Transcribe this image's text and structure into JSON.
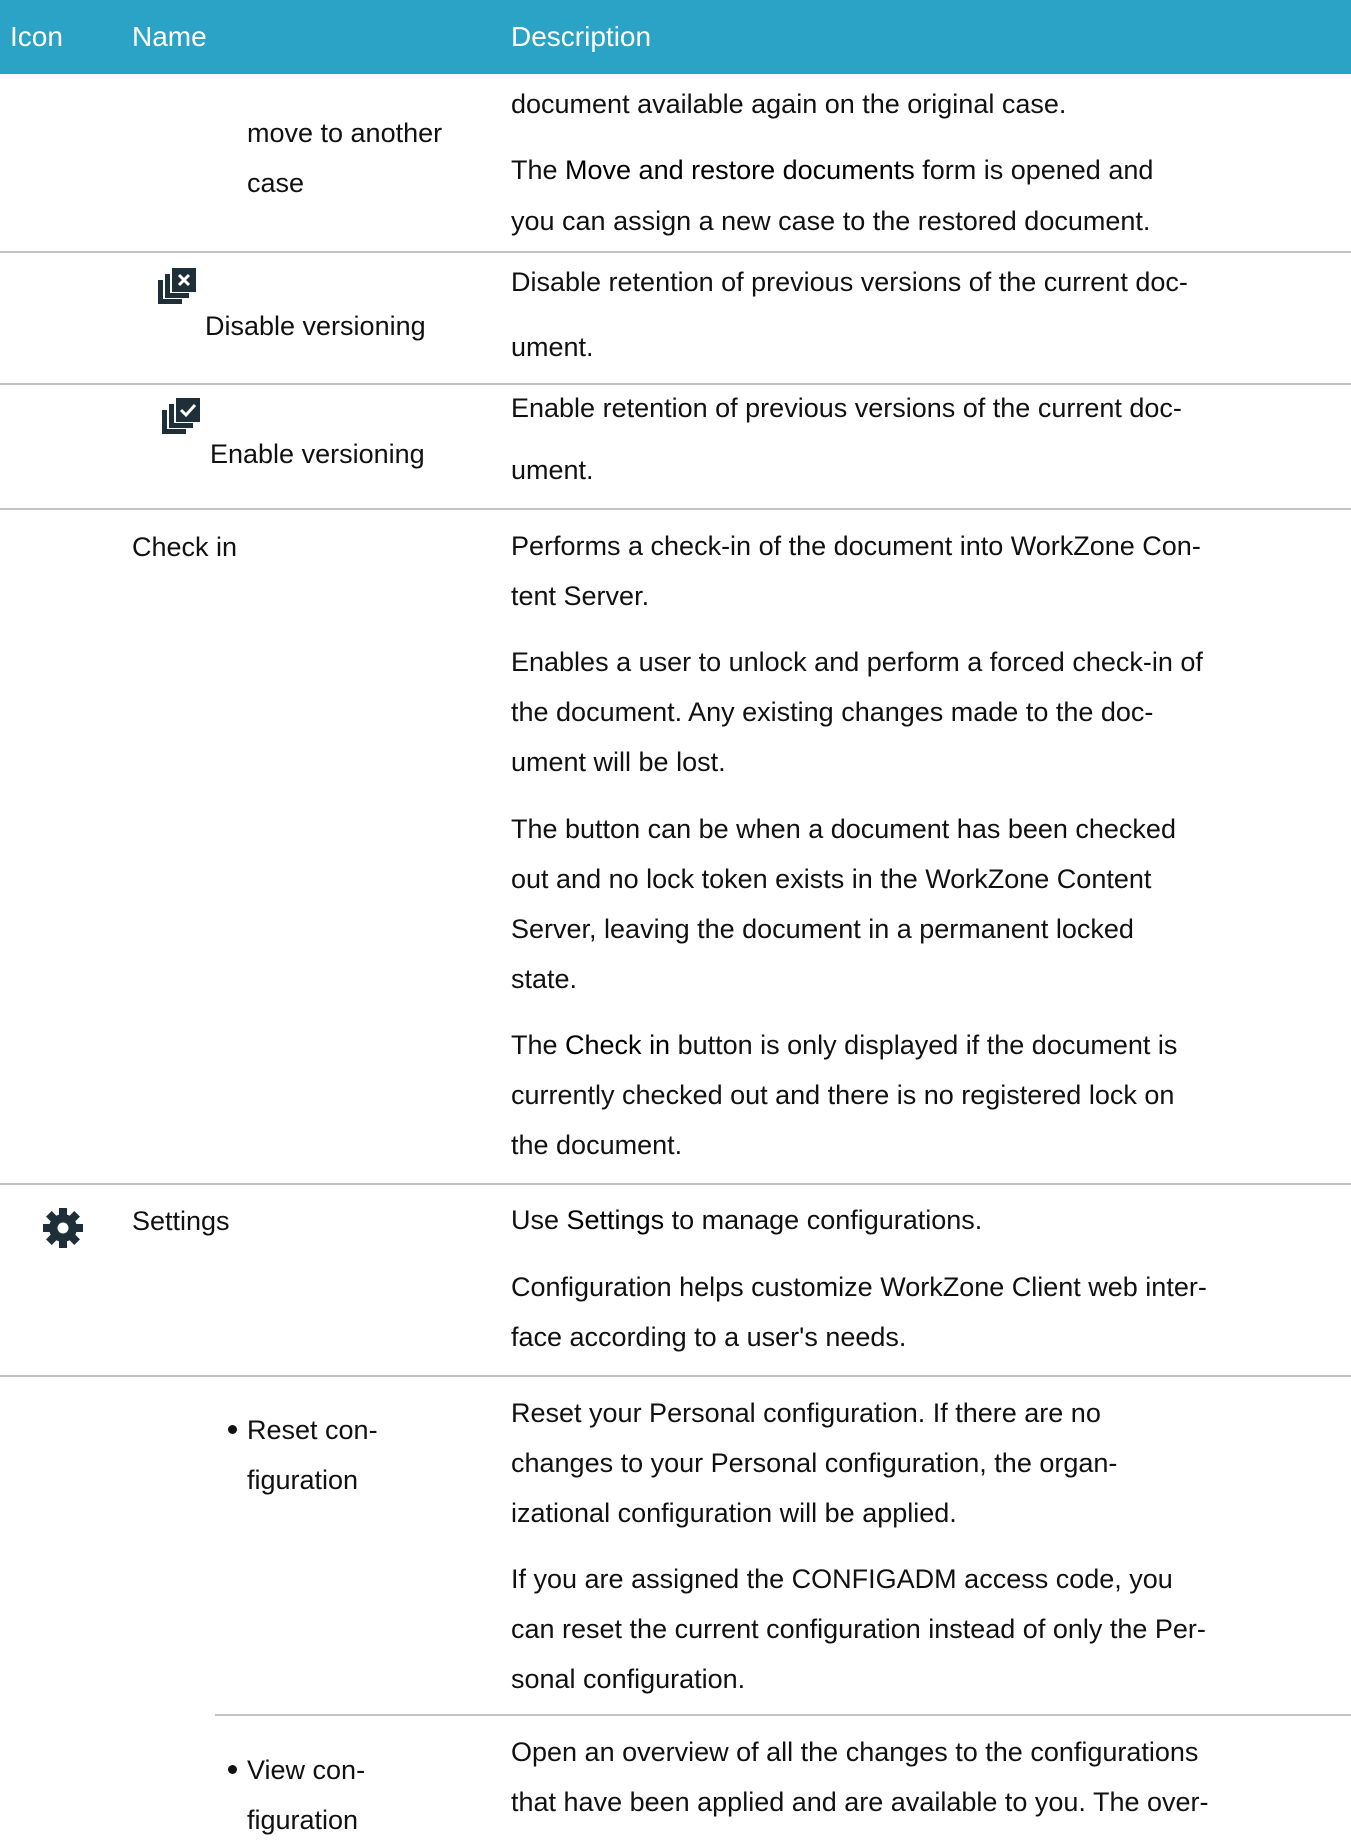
{
  "header": {
    "icon": "Icon",
    "name": "Name",
    "description": "Description"
  },
  "rows": [
    {
      "name_lines": [
        "move to another",
        "case"
      ],
      "desc_lines": [
        [
          "document available again on the original case."
        ],
        [
          "The ",
          {
            "b": "Move and restore documents"
          },
          " form is opened and"
        ],
        [
          "you can assign a new case to the restored document."
        ]
      ]
    },
    {
      "icon": "disable-versioning-icon",
      "name": "Disable versioning",
      "desc_lines": [
        [
          "Disable retention of previous versions of the current doc-"
        ],
        [
          "ument."
        ]
      ]
    },
    {
      "icon": "enable-versioning-icon",
      "name": "Enable versioning",
      "desc_lines": [
        [
          "Enable retention of previous versions of the current doc-"
        ],
        [
          "ument."
        ]
      ]
    },
    {
      "name": "Check in",
      "desc_lines": [
        [
          "Performs a check-in of the document into WorkZone Con-"
        ],
        [
          "tent Server."
        ],
        [
          "Enables a user to unlock and perform a forced check-in of"
        ],
        [
          "the document. Any existing changes made to the doc-"
        ],
        [
          "ument will be lost."
        ],
        [
          "The button can be when a document has been checked"
        ],
        [
          "out and no lock token exists in the WorkZone Content"
        ],
        [
          "Server, leaving the document in a permanent locked"
        ],
        [
          "state."
        ],
        [
          "The ",
          {
            "b": "Check in"
          },
          " button is only displayed if the document is"
        ],
        [
          "currently checked out and there is no registered lock on"
        ],
        [
          "the document."
        ]
      ]
    },
    {
      "icon": "gear-icon",
      "name": "Settings",
      "desc_lines": [
        [
          "Use ",
          {
            "b": "Settings"
          },
          " to manage configurations."
        ],
        [
          "Configuration helps customize WorkZone Client web inter-"
        ],
        [
          "face according to a user's needs."
        ]
      ]
    },
    {
      "bullet": true,
      "name_lines": [
        "Reset con-",
        "figuration"
      ],
      "desc_lines": [
        [
          "Reset your Personal configuration. If there are no"
        ],
        [
          "changes to your Personal configuration, the organ-"
        ],
        [
          "izational configuration will be applied."
        ],
        [
          "If you are assigned the CONFIGADM access code, you"
        ],
        [
          "can reset the current configuration instead of only the Per-"
        ],
        [
          "sonal configuration."
        ]
      ]
    },
    {
      "bullet": true,
      "name_lines": [
        "View con-",
        "figuration"
      ],
      "desc_lines": [
        [
          "Open an overview of all the changes to the configurations"
        ],
        [
          "that have been applied and are available to you. The over-"
        ]
      ]
    }
  ],
  "colors": {
    "header_bg": "#2aa3c6",
    "header_text": "#ffffff",
    "separator": "#c3c3c3",
    "icon": "#1f2f3a"
  }
}
